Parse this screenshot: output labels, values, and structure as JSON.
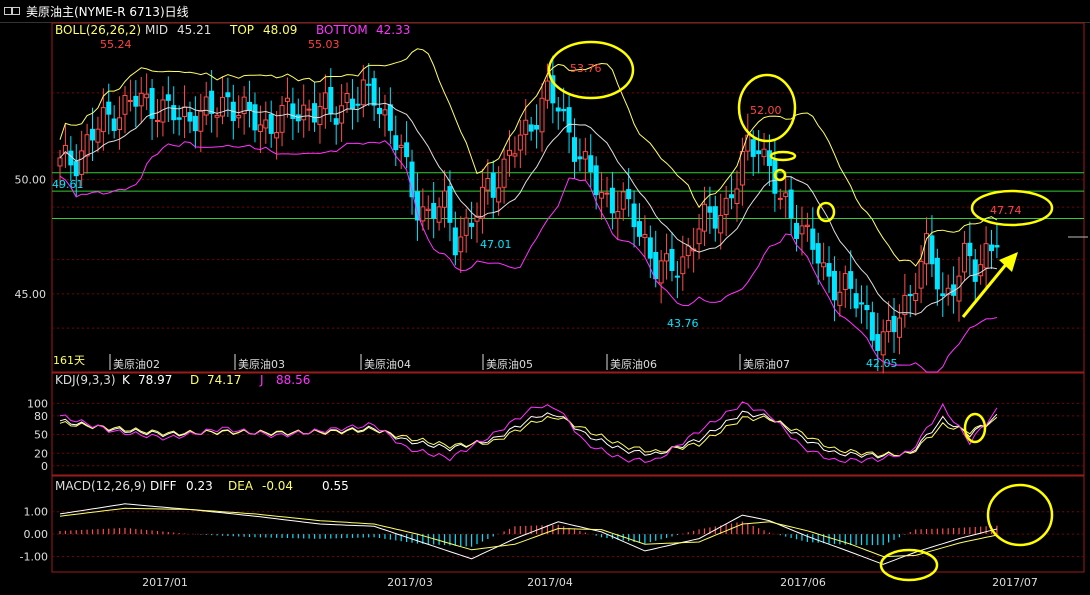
{
  "window": {
    "title": "美原油主(NYME-R 6713)日线"
  },
  "colors": {
    "up": "#ff4d4d",
    "down": "#00e5ff",
    "mid": "#dddddd",
    "top": "#ffff66",
    "bottom": "#ff33ff",
    "k": "#ffffff",
    "d": "#ffff66",
    "j": "#ff33ff",
    "annot": "#ffff00",
    "label_blue": "#00e5ff",
    "label_red": "#ff4444",
    "grid": "#7a0000",
    "hline": "#33cc33"
  },
  "chart_data": [
    {
      "type": "candlestick",
      "indicator_label": "BOLL(26,26,2)",
      "legend": {
        "mid_label": "MID",
        "mid_value": "45.21",
        "top_label": "TOP",
        "top_value": "48.09",
        "bottom_label": "BOTTOM",
        "bottom_value": "42.33"
      },
      "ylim": [
        41.8,
        56.2
      ],
      "y_ticks": [
        "50.00",
        "45.00"
      ],
      "y_tick_values": [
        50,
        45
      ],
      "horizontal_lines": [
        50.3,
        49.5,
        48.3
      ],
      "days_label": "161天",
      "contract_labels": [
        "美原油02",
        "美原油03",
        "美原油04",
        "美原油05",
        "美原油06",
        "美原油07"
      ],
      "x_ticks": [
        "2017/01",
        "2017/03",
        "2017/04",
        "2017/06",
        "2017/07"
      ],
      "price_labels": {
        "p1": "55.24",
        "p2": "55.03",
        "p3": "49.61",
        "p4": "47.01",
        "p5": "53.76",
        "p6": "43.76",
        "p7": "52.00",
        "p8": "42.05",
        "p9": "47.74"
      },
      "close_path": [
        [
          0,
          50.6
        ],
        [
          3,
          51.0
        ],
        [
          7,
          52.2
        ],
        [
          10,
          53.0
        ],
        [
          14,
          53.4
        ],
        [
          18,
          53.3
        ],
        [
          22,
          52.6
        ],
        [
          25,
          53.0
        ],
        [
          28,
          52.8
        ],
        [
          31,
          53.6
        ],
        [
          35,
          52.6
        ],
        [
          38,
          52.4
        ],
        [
          42,
          52.8
        ],
        [
          46,
          53.2
        ],
        [
          50,
          52.8
        ],
        [
          53,
          53.6
        ],
        [
          55,
          53.4
        ],
        [
          58,
          53.9
        ],
        [
          60,
          52.8
        ],
        [
          63,
          51.0
        ],
        [
          66,
          49.0
        ],
        [
          68,
          48.4
        ],
        [
          71,
          48.8
        ],
        [
          73,
          47.6
        ],
        [
          76,
          47.9
        ],
        [
          79,
          49.8
        ],
        [
          82,
          50.4
        ],
        [
          85,
          51.8
        ],
        [
          88,
          53.0
        ],
        [
          90,
          53.6
        ],
        [
          92,
          53.2
        ],
        [
          94,
          52.2
        ],
        [
          97,
          50.4
        ],
        [
          100,
          49.4
        ],
        [
          103,
          49.0
        ],
        [
          106,
          48.3
        ],
        [
          108,
          47.4
        ],
        [
          110,
          46.2
        ],
        [
          112,
          45.9
        ],
        [
          115,
          46.6
        ],
        [
          118,
          47.8
        ],
        [
          121,
          48.6
        ],
        [
          123,
          48.9
        ],
        [
          125,
          49.8
        ],
        [
          127,
          51.4
        ],
        [
          129,
          51.8
        ],
        [
          131,
          50.4
        ],
        [
          133,
          48.9
        ],
        [
          135,
          48.6
        ],
        [
          137,
          48.0
        ],
        [
          139,
          47.0
        ],
        [
          141,
          45.8
        ],
        [
          143,
          45.6
        ],
        [
          145,
          45.3
        ],
        [
          147,
          44.6
        ],
        [
          149,
          44.0
        ],
        [
          151,
          43.2
        ],
        [
          152,
          42.9
        ],
        [
          154,
          43.5
        ],
        [
          156,
          44.6
        ],
        [
          158,
          45.8
        ],
        [
          160,
          46.8
        ],
        [
          162,
          45.6
        ],
        [
          163,
          44.8
        ],
        [
          165,
          45.6
        ],
        [
          167,
          46.4
        ],
        [
          169,
          46.0
        ],
        [
          171,
          47.0
        ],
        [
          173,
          47.5
        ]
      ]
    },
    {
      "type": "line",
      "indicator_label": "KDJ(9,3,3)",
      "legend": {
        "k_label": "K",
        "k_value": "78.97",
        "d_label": "D",
        "d_value": "74.17",
        "j_label": "J",
        "j_value": "88.56"
      },
      "ylim": [
        -10,
        115
      ],
      "y_ticks": [
        "100",
        "80",
        "50",
        "20",
        "0"
      ],
      "y_tick_values": [
        100,
        80,
        50,
        20,
        0
      ],
      "series": [
        {
          "name": "K",
          "values": [
            [
              0,
              72
            ],
            [
              10,
              58
            ],
            [
              20,
              50
            ],
            [
              30,
              55
            ],
            [
              40,
              52
            ],
            [
              50,
              55
            ],
            [
              58,
              60
            ],
            [
              64,
              40
            ],
            [
              72,
              28
            ],
            [
              80,
              42
            ],
            [
              88,
              80
            ],
            [
              92,
              82
            ],
            [
              97,
              50
            ],
            [
              104,
              25
            ],
            [
              110,
              18
            ],
            [
              118,
              42
            ],
            [
              126,
              85
            ],
            [
              131,
              78
            ],
            [
              137,
              45
            ],
            [
              143,
              20
            ],
            [
              151,
              16
            ],
            [
              157,
              20
            ],
            [
              163,
              75
            ],
            [
              168,
              50
            ],
            [
              173,
              79
            ]
          ]
        },
        {
          "name": "D",
          "values": [
            [
              0,
              68
            ],
            [
              10,
              60
            ],
            [
              20,
              52
            ],
            [
              30,
              54
            ],
            [
              40,
              53
            ],
            [
              50,
              54
            ],
            [
              58,
              58
            ],
            [
              64,
              45
            ],
            [
              72,
              32
            ],
            [
              80,
              38
            ],
            [
              88,
              72
            ],
            [
              92,
              78
            ],
            [
              97,
              58
            ],
            [
              104,
              32
            ],
            [
              110,
              22
            ],
            [
              118,
              35
            ],
            [
              126,
              76
            ],
            [
              131,
              76
            ],
            [
              137,
              52
            ],
            [
              143,
              26
            ],
            [
              151,
              18
            ],
            [
              157,
              19
            ],
            [
              163,
              65
            ],
            [
              168,
              55
            ],
            [
              173,
              74
            ]
          ]
        },
        {
          "name": "J",
          "values": [
            [
              0,
              80
            ],
            [
              10,
              55
            ],
            [
              20,
              44
            ],
            [
              30,
              60
            ],
            [
              40,
              48
            ],
            [
              50,
              58
            ],
            [
              58,
              66
            ],
            [
              64,
              28
            ],
            [
              72,
              12
            ],
            [
              80,
              50
            ],
            [
              88,
              96
            ],
            [
              92,
              92
            ],
            [
              97,
              36
            ],
            [
              104,
              10
            ],
            [
              110,
              8
            ],
            [
              118,
              56
            ],
            [
              126,
              100
            ],
            [
              131,
              82
            ],
            [
              137,
              30
            ],
            [
              143,
              8
            ],
            [
              151,
              10
            ],
            [
              157,
              22
            ],
            [
              163,
              95
            ],
            [
              168,
              38
            ],
            [
              173,
              89
            ]
          ]
        }
      ]
    },
    {
      "type": "bar",
      "indicator_label": "MACD(12,26,9)",
      "legend": {
        "diff_label": "DIFF",
        "diff_value": "0.23",
        "dea_label": "DEA",
        "dea_value": "-0.04",
        "extra_value": "0.55"
      },
      "ylim": [
        -1.6,
        1.7
      ],
      "y_ticks": [
        "1.00",
        "0.00",
        "-1.00"
      ],
      "y_tick_values": [
        1,
        0,
        -1
      ],
      "diff": [
        [
          0,
          0.9
        ],
        [
          12,
          1.35
        ],
        [
          24,
          1.1
        ],
        [
          36,
          0.8
        ],
        [
          48,
          0.45
        ],
        [
          58,
          0.35
        ],
        [
          66,
          -0.3
        ],
        [
          76,
          -1.1
        ],
        [
          84,
          -0.2
        ],
        [
          92,
          0.55
        ],
        [
          100,
          0.1
        ],
        [
          108,
          -0.75
        ],
        [
          118,
          -0.2
        ],
        [
          126,
          0.85
        ],
        [
          131,
          0.6
        ],
        [
          138,
          -0.1
        ],
        [
          146,
          -0.8
        ],
        [
          152,
          -1.35
        ],
        [
          158,
          -0.8
        ],
        [
          166,
          -0.2
        ],
        [
          173,
          0.23
        ]
      ],
      "dea": [
        [
          0,
          0.8
        ],
        [
          12,
          1.15
        ],
        [
          24,
          1.1
        ],
        [
          36,
          0.9
        ],
        [
          48,
          0.6
        ],
        [
          58,
          0.45
        ],
        [
          66,
          0.0
        ],
        [
          76,
          -0.7
        ],
        [
          84,
          -0.45
        ],
        [
          92,
          0.25
        ],
        [
          100,
          0.2
        ],
        [
          108,
          -0.45
        ],
        [
          118,
          -0.35
        ],
        [
          126,
          0.45
        ],
        [
          131,
          0.55
        ],
        [
          138,
          0.15
        ],
        [
          146,
          -0.45
        ],
        [
          152,
          -1.0
        ],
        [
          158,
          -0.95
        ],
        [
          166,
          -0.4
        ],
        [
          173,
          -0.04
        ]
      ]
    }
  ]
}
